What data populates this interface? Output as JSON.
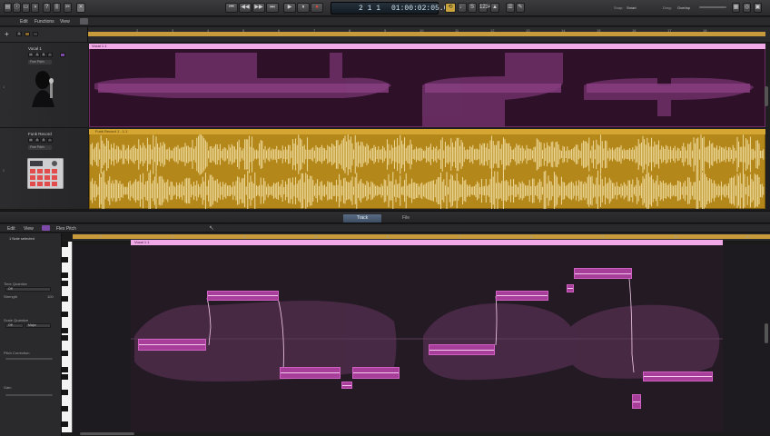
{
  "control_bar": {
    "lcd_bars": "2 1 1",
    "lcd_time": "01:00:02:05.04",
    "transport": [
      "⏮",
      "◀◀",
      "▶▶",
      "⏭",
      "▶",
      "⏸",
      "●"
    ],
    "right_labels": {
      "snap": "Snap:",
      "snap_value": "Smart",
      "drag": "Drag:",
      "drag_value": "Overlap"
    }
  },
  "main_menu": {
    "items": [
      "Edit",
      "Functions",
      "View"
    ]
  },
  "tracks": [
    {
      "name": "Vocal 1",
      "input": "Fine Pitch",
      "number": "1",
      "icon": "singer-icon"
    },
    {
      "name": "Funk Record",
      "input": "Fine Pitch",
      "number": "2",
      "icon": "drum-machine-icon"
    }
  ],
  "regions": {
    "vocal": "Vocal 1.1",
    "funk": "Funk Record 1 - 1.1"
  },
  "ruler_labels": [
    "2",
    "3",
    "4",
    "5",
    "6",
    "7",
    "8",
    "9",
    "10",
    "11",
    "12",
    "13",
    "14",
    "15",
    "16",
    "17",
    "18"
  ],
  "tabs": {
    "track": "Track",
    "file": "File"
  },
  "editor_menu": {
    "items": [
      "Edit",
      "View"
    ],
    "mode": "Flex Pitch"
  },
  "inspector": {
    "selection": "1 Note selected",
    "time_quantize": "Time Quantize",
    "tq_value": "Off",
    "strength": "Strength",
    "strength_value": "100",
    "scale_quantize": "Scale Quantize",
    "sq_value": "Off",
    "sq_scale": "Major",
    "pitch_correction": "Pitch Correction",
    "gain": "Gain"
  },
  "editor_ruler_labels": [
    "2",
    "3",
    "4",
    "5",
    "6",
    "7",
    "8",
    "9",
    "10",
    "11",
    "12"
  ],
  "editor_region": "Vocal 1.1",
  "colors": {
    "vocal_region": "#2e1129",
    "funk_region": "#b4871a",
    "note": "#a73f9a",
    "accent_cycle": "#c79a3c"
  }
}
